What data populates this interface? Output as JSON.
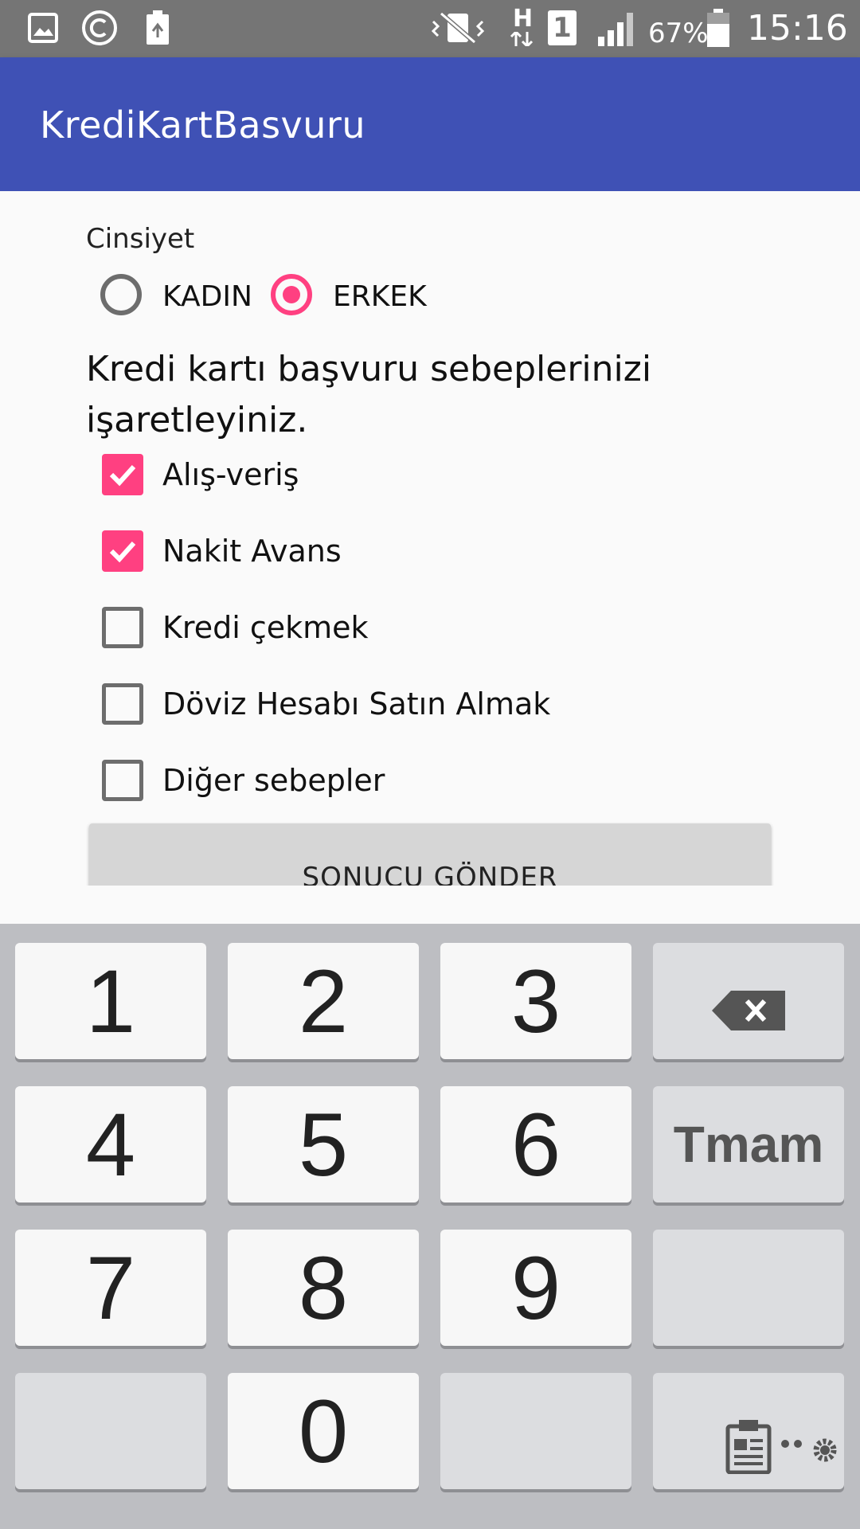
{
  "status_bar": {
    "battery_percent": "67%",
    "time": "15:16",
    "sim_label": "1",
    "network_label": "H",
    "icons": [
      "gallery-icon",
      "copyright-icon",
      "recycle-icon",
      "vibrate-icon",
      "network-h-icon",
      "sim-1-icon",
      "signal-icon",
      "battery-icon"
    ]
  },
  "app_bar": {
    "title": "KrediKartBasvuru"
  },
  "form": {
    "gender_label": "Cinsiyet",
    "gender_options": [
      {
        "label": "KADIN",
        "checked": false
      },
      {
        "label": "ERKEK",
        "checked": true
      }
    ],
    "question": "Kredi kartı başvuru sebeplerinizi işaretleyiniz.",
    "reasons": [
      {
        "label": "Alış-veriş",
        "checked": true
      },
      {
        "label": "Nakit Avans",
        "checked": true
      },
      {
        "label": "Kredi çekmek",
        "checked": false
      },
      {
        "label": "Döviz Hesabı Satın Almak",
        "checked": false
      },
      {
        "label": "Diğer sebepler",
        "checked": false
      }
    ],
    "submit_label": "SONUCU GÖNDER"
  },
  "keyboard": {
    "keys": [
      "1",
      "2",
      "3",
      "4",
      "5",
      "6",
      "7",
      "8",
      "9",
      "0"
    ],
    "done_label": "Tmam",
    "icons": [
      "backspace-icon",
      "clipboard-icon",
      "settings-icon"
    ]
  },
  "colors": {
    "primary": "#3F51B5",
    "accent": "#FF4081",
    "status_bar": "#757575",
    "keyboard_bg": "#BDBEC2"
  }
}
